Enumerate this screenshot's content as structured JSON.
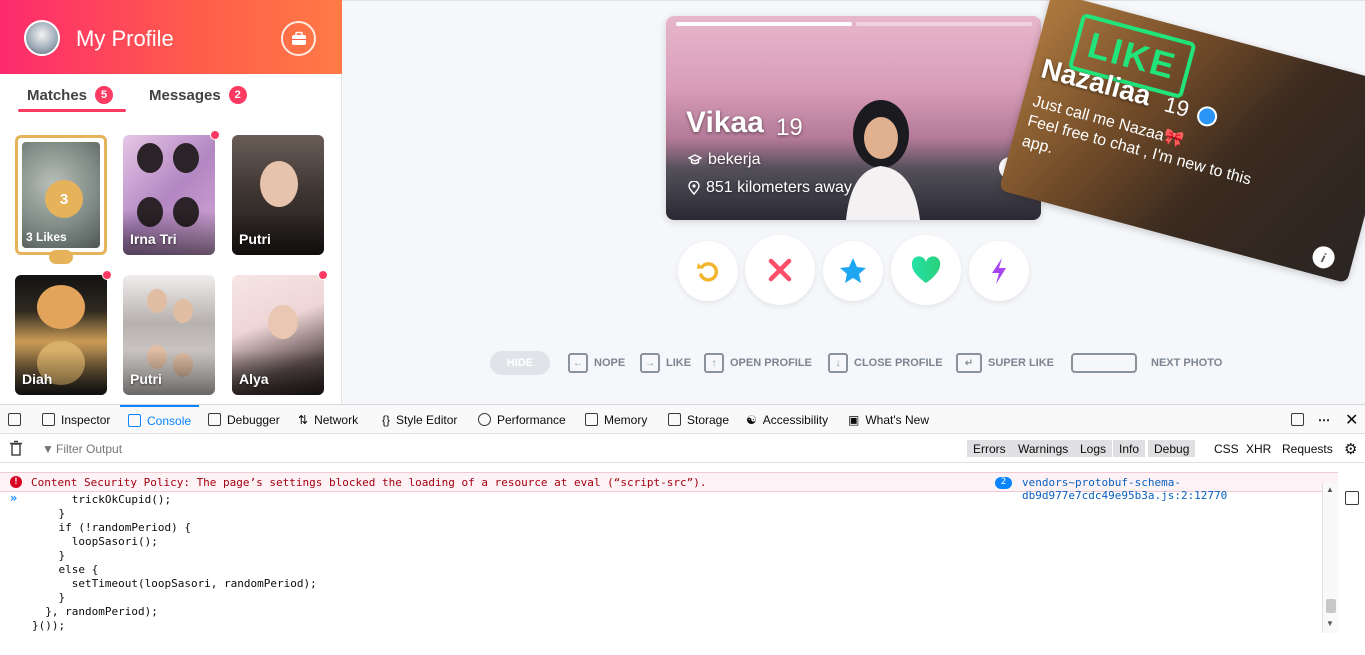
{
  "sidebar": {
    "title": "My Profile",
    "tabs": [
      {
        "label": "Matches",
        "count": "5"
      },
      {
        "label": "Messages",
        "count": "2"
      }
    ],
    "likes_card": {
      "count": "3",
      "label": "3 Likes"
    },
    "matches": [
      {
        "name": "Irna Tri",
        "new": true
      },
      {
        "name": "Putri",
        "new": false
      },
      {
        "name": "Diah",
        "new": true
      },
      {
        "name": "Putri",
        "new": false
      },
      {
        "name": "Alya",
        "new": true
      }
    ]
  },
  "cards": {
    "current": {
      "name": "Vikaa",
      "age": "19",
      "job": "bekerja",
      "distance": "851 kilometers away",
      "photo_count": 2,
      "photo_index": 1
    },
    "swiped": {
      "stamp": "LIKE",
      "name": "Nazaliaa",
      "age": "19",
      "bio_line1": "Just call me Nazaa🎀",
      "bio_line2": "Feel free to chat , I'm new to this",
      "bio_line3": "app."
    }
  },
  "action_buttons": [
    {
      "name": "rewind",
      "color": "#f3b52e"
    },
    {
      "name": "nope",
      "color": "#fd4f68"
    },
    {
      "name": "super-like",
      "color": "#1fa6f2"
    },
    {
      "name": "like",
      "color": "#21d8a3"
    },
    {
      "name": "boost",
      "color": "#a646f2"
    }
  ],
  "shortcuts": {
    "hide": "HIDE",
    "nope": "NOPE",
    "like": "LIKE",
    "open_profile": "OPEN PROFILE",
    "close_profile": "CLOSE PROFILE",
    "super_like": "SUPER LIKE",
    "next_photo": "NEXT PHOTO"
  },
  "devtools": {
    "tabs": [
      "Inspector",
      "Console",
      "Debugger",
      "Network",
      "Style Editor",
      "Performance",
      "Memory",
      "Storage",
      "Accessibility",
      "What's New"
    ],
    "active_tab": "Console",
    "filter_placeholder": "Filter Output",
    "filters": [
      "Errors",
      "Warnings",
      "Logs",
      "Info",
      "Debug"
    ],
    "extra_filters": [
      "CSS",
      "XHR",
      "Requests"
    ],
    "error": {
      "message": "Content Security Policy: The page’s settings blocked the loading of a resource at eval (“script-src”).",
      "count": "2",
      "source": "vendors~protobuf-schema-db9d977e7cdc49e95b3a.js:2:12770"
    },
    "code_lines": [
      "      trickOkCupid();",
      "    }",
      "    if (!randomPeriod) {",
      "      loopSasori();",
      "    }",
      "    else {",
      "      setTimeout(loopSasori, randomPeriod);",
      "    }",
      "  }, randomPeriod);",
      "}());"
    ]
  },
  "colors": {
    "brand_gradient_start": "#fd2a6e",
    "brand_gradient_end": "#ff7a45",
    "badge": "#fd3a61",
    "gold": "#e6b35a",
    "like_green": "#21e47a",
    "devtools_accent": "#0a84ff"
  }
}
